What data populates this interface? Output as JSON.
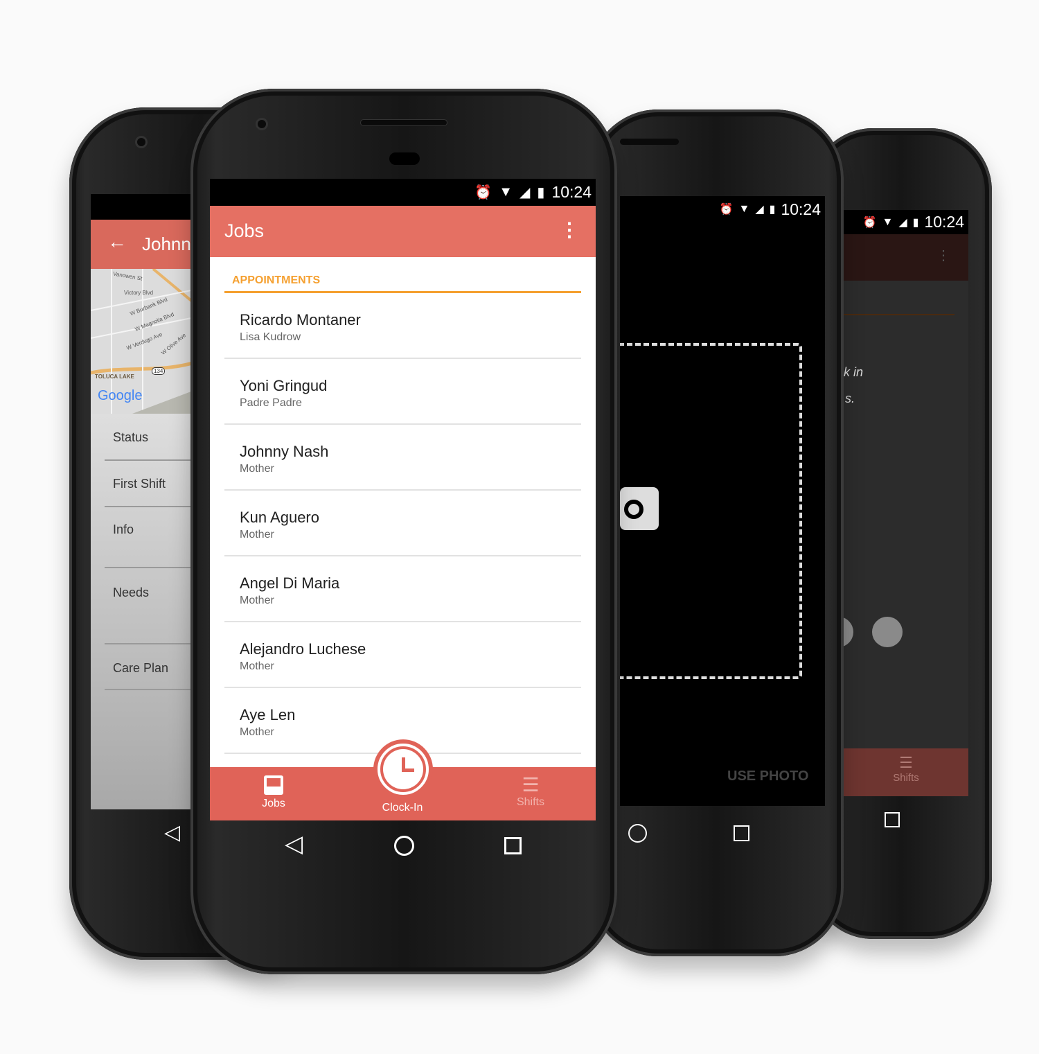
{
  "status_bar": {
    "time": "10:24",
    "icons": [
      "alarm-icon",
      "wifi-icon",
      "signal-icon",
      "battery-charging-icon"
    ]
  },
  "left_phone": {
    "app_bar": {
      "title": "Johnn",
      "back_icon": "arrow-left-icon"
    },
    "map": {
      "labels": [
        "Vanowen St",
        "Victory Blvd",
        "W Burbank Blvd",
        "W Magnolia Blvd",
        "W Verdugo Ave",
        "W Olive Ave",
        "TOLUCA LAKE",
        "134",
        "Google"
      ]
    },
    "rows": [
      {
        "label": "Status"
      },
      {
        "label": "First Shift"
      },
      {
        "label": "Info"
      },
      {
        "label": "Needs"
      },
      {
        "label": "Care Plan"
      }
    ]
  },
  "front_phone": {
    "app_bar": {
      "title": "Jobs",
      "menu_icon": "more-vert-icon"
    },
    "tab": {
      "label": "APPOINTMENTS"
    },
    "appointments": [
      {
        "name": "Ricardo Montaner",
        "relation": "Lisa Kudrow"
      },
      {
        "name": "Yoni Gringud",
        "relation": "Padre Padre"
      },
      {
        "name": "Johnny Nash",
        "relation": "Mother"
      },
      {
        "name": "Kun Aguero",
        "relation": "Mother"
      },
      {
        "name": "Angel Di Maria",
        "relation": "Mother"
      },
      {
        "name": "Alejandro Luchese",
        "relation": "Mother"
      },
      {
        "name": "Aye Len",
        "relation": "Mother"
      }
    ],
    "bottom_nav": [
      {
        "label": "Jobs",
        "icon": "inbox-icon"
      },
      {
        "label": "Clock-In",
        "icon": "clock-icon"
      },
      {
        "label": "Shifts",
        "icon": "list-icon"
      }
    ]
  },
  "camera_phone": {
    "use_photo": "USE PHOTO",
    "icon": "camera-icon"
  },
  "right_phone": {
    "text1": "k in",
    "text2": "s.",
    "bottom_nav": {
      "label": "Shifts",
      "icon": "list-icon"
    }
  },
  "colors": {
    "primary": "#e57063",
    "bottom_bar": "#e06358",
    "accent": "#f5a030"
  }
}
